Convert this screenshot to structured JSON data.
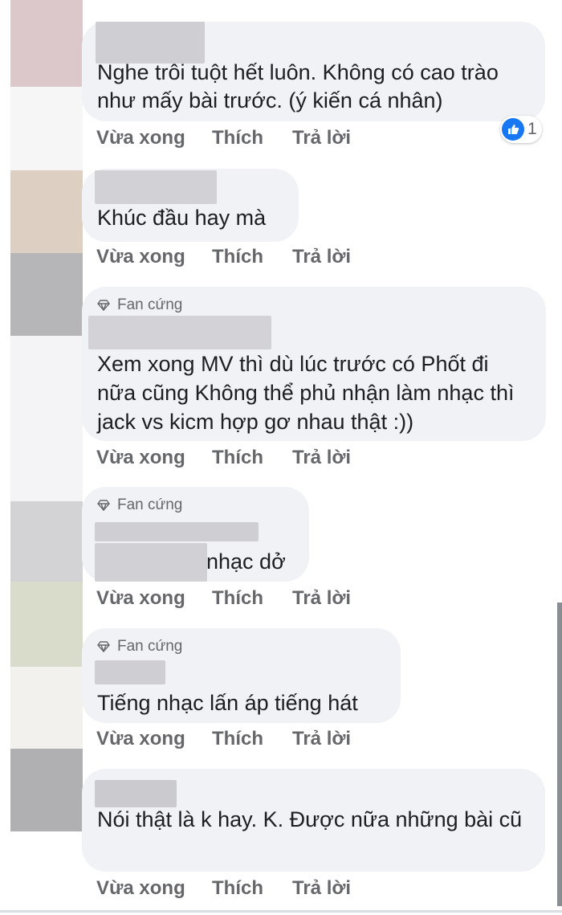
{
  "badge_label": "Fan cứng",
  "action_labels": {
    "time": "Vừa xong",
    "like": "Thích",
    "reply": "Trả lời"
  },
  "comments": [
    {
      "text": "Nghe trôi tuột hết luôn. Không có cao trào như mấy bài trước. (ý kiến cá nhân)",
      "reaction": {
        "icon": "like-icon",
        "count": "1"
      }
    },
    {
      "text": "Khúc đầu hay mà"
    },
    {
      "badge": true,
      "text": "Xem xong MV thì dù lúc trước có Phốt đi nữa cũng Không thể phủ nhận làm nhạc thì jack vs kicm hợp gơ nhau thật :))"
    },
    {
      "badge": true,
      "text": "nhạc dở"
    },
    {
      "badge": true,
      "text": "Tiếng nhạc lấn áp tiếng hát"
    },
    {
      "text": "Nói thật là k hay. K. Được nữa những bài cũ"
    }
  ],
  "colors": {
    "bubble": "#f0f2f5",
    "action_text": "#65676b",
    "like_blue": "#1877f2",
    "blur": "#c9c9cc",
    "avatar_pink": "#dcc8ca",
    "avatar_beige": "#ddd0c2",
    "avatar_gray": "#b6b6b8",
    "avatar_green": "#d9dccb"
  }
}
